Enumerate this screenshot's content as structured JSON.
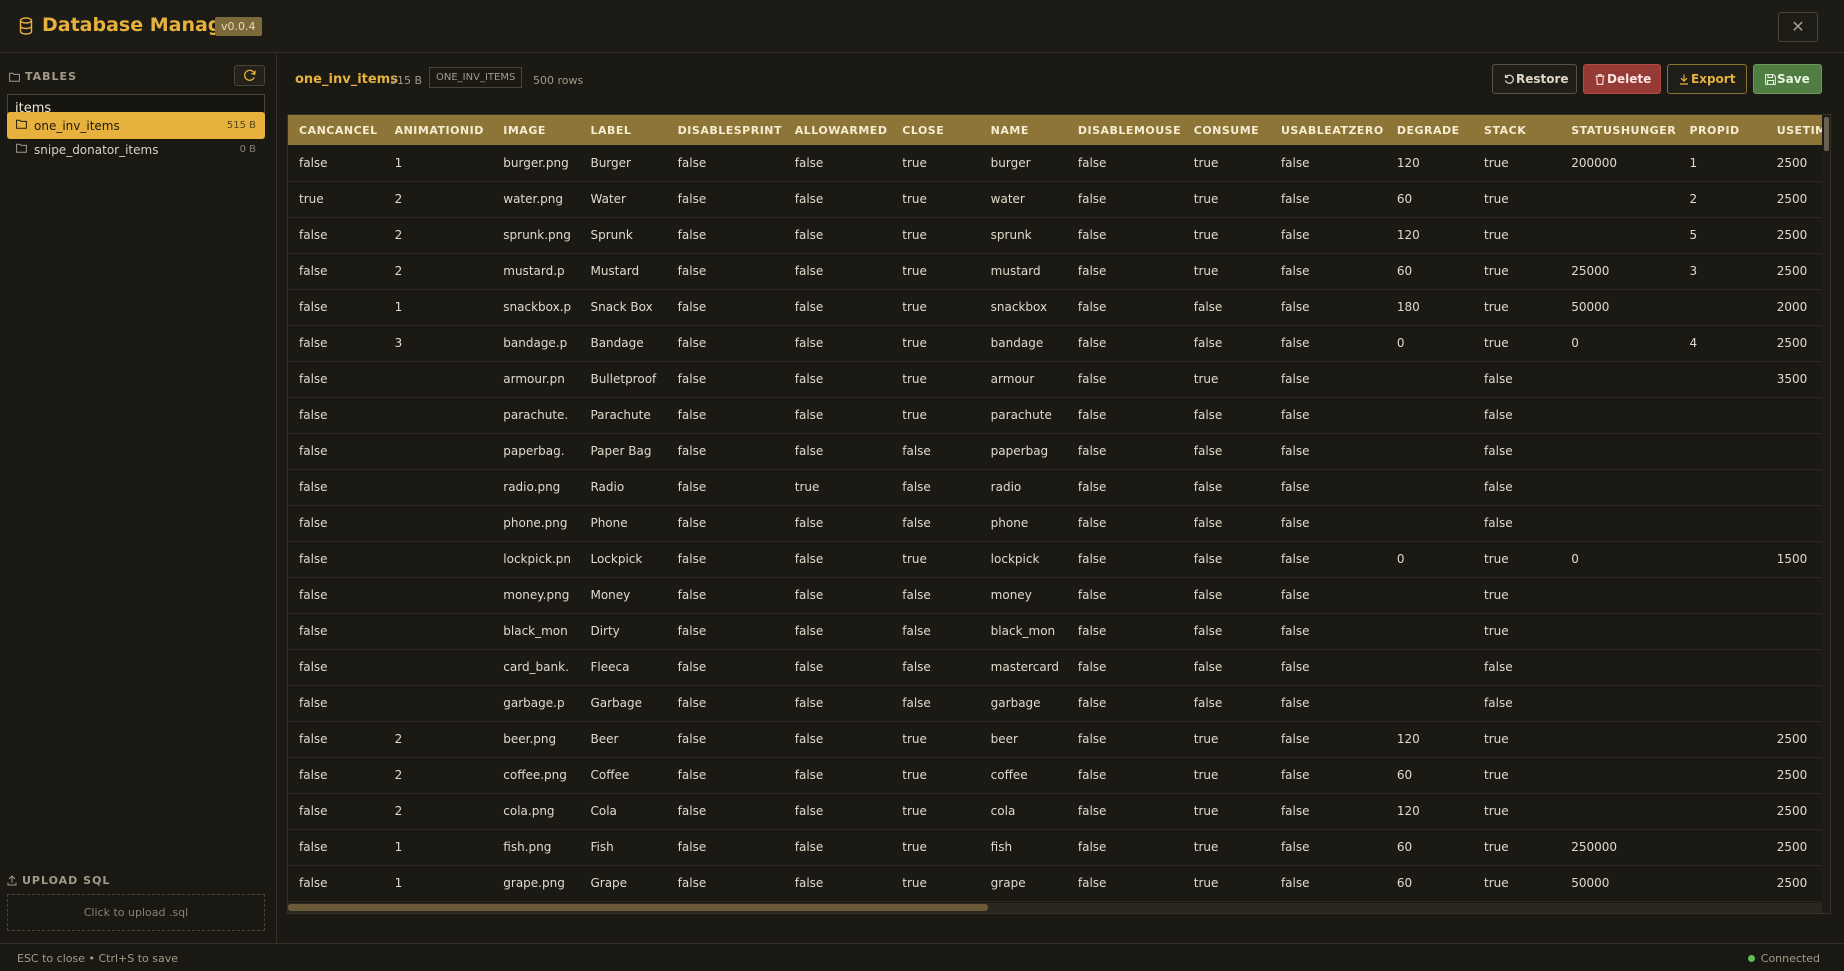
{
  "header": {
    "title": "Database Manager",
    "version": "v0.0.4",
    "close_symbol": "✕"
  },
  "sidebar": {
    "tables_heading": "TABLES",
    "search_value": "items",
    "tables": [
      {
        "name": "one_inv_items",
        "size": "515 B",
        "active": true
      },
      {
        "name": "snipe_donator_items",
        "size": "0 B",
        "active": false
      }
    ],
    "upload_heading": "UPLOAD SQL",
    "upload_text": "Click to upload .sql"
  },
  "main": {
    "table_name": "one_inv_items",
    "table_size": "515 B",
    "table_tag": "ONE_INV_ITEMS",
    "row_count": "500 rows",
    "buttons": {
      "restore": "Restore",
      "delete": "Delete",
      "export": "Export",
      "save": "Save"
    }
  },
  "grid": {
    "columns": [
      "CANCANCEL",
      "ANIMATIONID",
      "IMAGE",
      "LABEL",
      "DISABLESPRINT",
      "ALLOWARMED",
      "CLOSE",
      "NAME",
      "DISABLEMOUSE",
      "CONSUME",
      "USABLEATZERO",
      "DEGRADE",
      "STACK",
      "STATUSHUNGER",
      "PROPID",
      "USETIME"
    ],
    "rows": [
      [
        "false",
        "1",
        "burger.png",
        "Burger",
        "false",
        "false",
        "true",
        "burger",
        "false",
        "true",
        "false",
        "120",
        "true",
        "200000",
        "1",
        "2500"
      ],
      [
        "true",
        "2",
        "water.png",
        "Water",
        "false",
        "false",
        "true",
        "water",
        "false",
        "true",
        "false",
        "60",
        "true",
        "",
        "2",
        "2500"
      ],
      [
        "false",
        "2",
        "sprunk.png",
        "Sprunk",
        "false",
        "false",
        "true",
        "sprunk",
        "false",
        "true",
        "false",
        "120",
        "true",
        "",
        "5",
        "2500"
      ],
      [
        "false",
        "2",
        "mustard.p",
        "Mustard",
        "false",
        "false",
        "true",
        "mustard",
        "false",
        "true",
        "false",
        "60",
        "true",
        "25000",
        "3",
        "2500"
      ],
      [
        "false",
        "1",
        "snackbox.p",
        "Snack Box",
        "false",
        "false",
        "true",
        "snackbox",
        "false",
        "false",
        "false",
        "180",
        "true",
        "50000",
        "",
        "2000"
      ],
      [
        "false",
        "3",
        "bandage.p",
        "Bandage",
        "false",
        "false",
        "true",
        "bandage",
        "false",
        "false",
        "false",
        "0",
        "true",
        "0",
        "4",
        "2500"
      ],
      [
        "false",
        "",
        "armour.pn",
        "Bulletproof",
        "false",
        "false",
        "true",
        "armour",
        "false",
        "true",
        "false",
        "",
        "false",
        "",
        "",
        "3500"
      ],
      [
        "false",
        "",
        "parachute.",
        "Parachute",
        "false",
        "false",
        "true",
        "parachute",
        "false",
        "false",
        "false",
        "",
        "false",
        "",
        "",
        ""
      ],
      [
        "false",
        "",
        "paperbag.",
        "Paper Bag",
        "false",
        "false",
        "false",
        "paperbag",
        "false",
        "false",
        "false",
        "",
        "false",
        "",
        "",
        ""
      ],
      [
        "false",
        "",
        "radio.png",
        "Radio",
        "false",
        "true",
        "false",
        "radio",
        "false",
        "false",
        "false",
        "",
        "false",
        "",
        "",
        ""
      ],
      [
        "false",
        "",
        "phone.png",
        "Phone",
        "false",
        "false",
        "false",
        "phone",
        "false",
        "false",
        "false",
        "",
        "false",
        "",
        "",
        ""
      ],
      [
        "false",
        "",
        "lockpick.pn",
        "Lockpick",
        "false",
        "false",
        "true",
        "lockpick",
        "false",
        "false",
        "false",
        "0",
        "true",
        "0",
        "",
        "1500"
      ],
      [
        "false",
        "",
        "money.png",
        "Money",
        "false",
        "false",
        "false",
        "money",
        "false",
        "false",
        "false",
        "",
        "true",
        "",
        "",
        ""
      ],
      [
        "false",
        "",
        "black_mon",
        "Dirty",
        "false",
        "false",
        "false",
        "black_mon",
        "false",
        "false",
        "false",
        "",
        "true",
        "",
        "",
        ""
      ],
      [
        "false",
        "",
        "card_bank.",
        "Fleeca",
        "false",
        "false",
        "false",
        "mastercard",
        "false",
        "false",
        "false",
        "",
        "false",
        "",
        "",
        ""
      ],
      [
        "false",
        "",
        "garbage.p",
        "Garbage",
        "false",
        "false",
        "false",
        "garbage",
        "false",
        "false",
        "false",
        "",
        "false",
        "",
        "",
        ""
      ],
      [
        "false",
        "2",
        "beer.png",
        "Beer",
        "false",
        "false",
        "true",
        "beer",
        "false",
        "true",
        "false",
        "120",
        "true",
        "",
        "",
        "2500"
      ],
      [
        "false",
        "2",
        "coffee.png",
        "Coffee",
        "false",
        "false",
        "true",
        "coffee",
        "false",
        "true",
        "false",
        "60",
        "true",
        "",
        "",
        "2500"
      ],
      [
        "false",
        "2",
        "cola.png",
        "Cola",
        "false",
        "false",
        "true",
        "cola",
        "false",
        "true",
        "false",
        "120",
        "true",
        "",
        "",
        "2500"
      ],
      [
        "false",
        "1",
        "fish.png",
        "Fish",
        "false",
        "false",
        "true",
        "fish",
        "false",
        "true",
        "false",
        "60",
        "true",
        "250000",
        "",
        "2500"
      ],
      [
        "false",
        "1",
        "grape.png",
        "Grape",
        "false",
        "false",
        "true",
        "grape",
        "false",
        "true",
        "false",
        "60",
        "true",
        "50000",
        "",
        "2500"
      ]
    ]
  },
  "footer": {
    "hint": "ESC to close • Ctrl+S to save",
    "status": "Connected"
  },
  "colors": {
    "accent": "#e6b13c",
    "header_row": "#8d7437",
    "delete": "#963a36",
    "save": "#4f7d42",
    "connected": "#5fbf5a"
  }
}
